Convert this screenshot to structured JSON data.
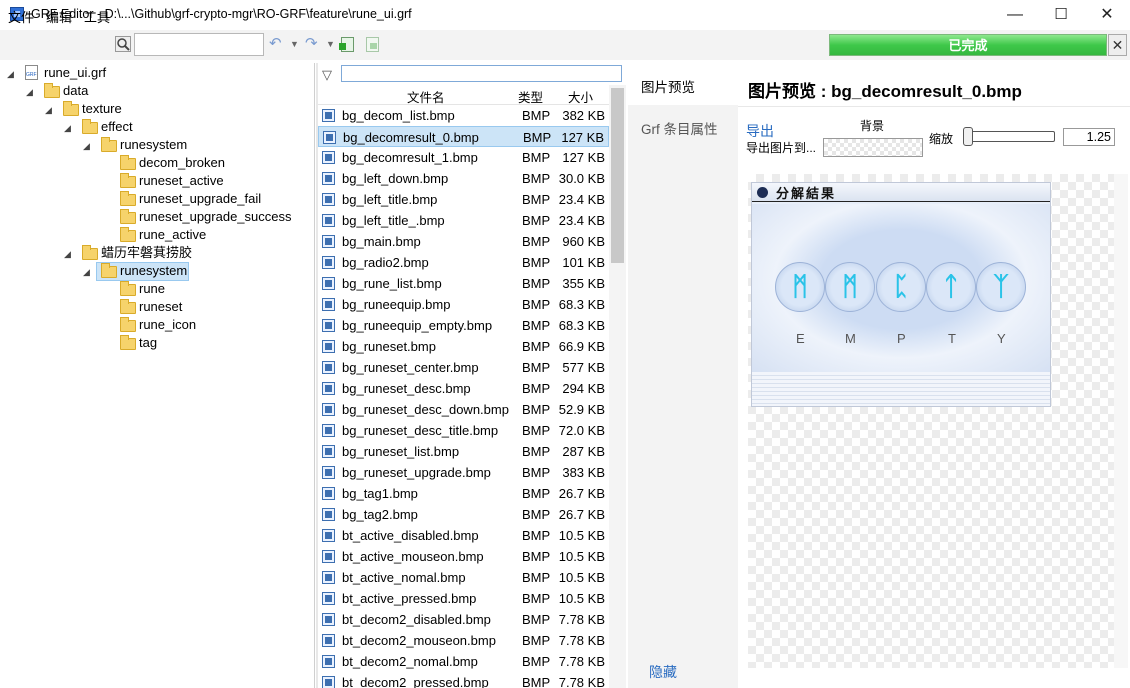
{
  "window": {
    "title": "GRF Editor - D:\\...\\Github\\grf-crypto-mgr\\RO-GRF\\feature\\rune_ui.grf",
    "minimize": "—",
    "maximize": "☐",
    "close": "✕"
  },
  "menu": {
    "file": "文件",
    "edit": "编辑",
    "tools": "工具"
  },
  "toolbar": {
    "search_value": "",
    "undo": "↶",
    "redo": "↷"
  },
  "progress": {
    "label": "已完成",
    "close": "✕",
    "percent": 100
  },
  "tree": {
    "root": "rune_ui.grf",
    "data": "data",
    "texture": "texture",
    "effect": "effect",
    "runesystem_a": "runesystem",
    "runesystem_a_children": [
      "decom_broken",
      "runeset_active",
      "runeset_upgrade_fail",
      "runeset_upgrade_success",
      "rune_active"
    ],
    "garbled": "蜡历牢磐萁捞胶",
    "runesystem_b": "runesystem",
    "runesystem_b_children": [
      "rune",
      "runeset",
      "rune_icon",
      "tag"
    ]
  },
  "filelist": {
    "filter_value": "",
    "headers": {
      "name": "文件名",
      "type": "类型",
      "size": "大小"
    },
    "rows": [
      {
        "name": "bg_decom_list.bmp",
        "type": "BMP",
        "size": "382 KB"
      },
      {
        "name": "bg_decomresult_0.bmp",
        "type": "BMP",
        "size": "127 KB"
      },
      {
        "name": "bg_decomresult_1.bmp",
        "type": "BMP",
        "size": "127 KB"
      },
      {
        "name": "bg_left_down.bmp",
        "type": "BMP",
        "size": "30.0 KB"
      },
      {
        "name": "bg_left_title.bmp",
        "type": "BMP",
        "size": "23.4 KB"
      },
      {
        "name": "bg_left_title_.bmp",
        "type": "BMP",
        "size": "23.4 KB"
      },
      {
        "name": "bg_main.bmp",
        "type": "BMP",
        "size": "960 KB"
      },
      {
        "name": "bg_radio2.bmp",
        "type": "BMP",
        "size": "101 KB"
      },
      {
        "name": "bg_rune_list.bmp",
        "type": "BMP",
        "size": "355 KB"
      },
      {
        "name": "bg_runeequip.bmp",
        "type": "BMP",
        "size": "68.3 KB"
      },
      {
        "name": "bg_runeequip_empty.bmp",
        "type": "BMP",
        "size": "68.3 KB"
      },
      {
        "name": "bg_runeset.bmp",
        "type": "BMP",
        "size": "66.9 KB"
      },
      {
        "name": "bg_runeset_center.bmp",
        "type": "BMP",
        "size": "577 KB"
      },
      {
        "name": "bg_runeset_desc.bmp",
        "type": "BMP",
        "size": "294 KB"
      },
      {
        "name": "bg_runeset_desc_down.bmp",
        "type": "BMP",
        "size": "52.9 KB"
      },
      {
        "name": "bg_runeset_desc_title.bmp",
        "type": "BMP",
        "size": "72.0 KB"
      },
      {
        "name": "bg_runeset_list.bmp",
        "type": "BMP",
        "size": "287 KB"
      },
      {
        "name": "bg_runeset_upgrade.bmp",
        "type": "BMP",
        "size": "383 KB"
      },
      {
        "name": "bg_tag1.bmp",
        "type": "BMP",
        "size": "26.7 KB"
      },
      {
        "name": "bg_tag2.bmp",
        "type": "BMP",
        "size": "26.7 KB"
      },
      {
        "name": "bt_active_disabled.bmp",
        "type": "BMP",
        "size": "10.5 KB"
      },
      {
        "name": "bt_active_mouseon.bmp",
        "type": "BMP",
        "size": "10.5 KB"
      },
      {
        "name": "bt_active_nomal.bmp",
        "type": "BMP",
        "size": "10.5 KB"
      },
      {
        "name": "bt_active_pressed.bmp",
        "type": "BMP",
        "size": "10.5 KB"
      },
      {
        "name": "bt_decom2_disabled.bmp",
        "type": "BMP",
        "size": "7.78 KB"
      },
      {
        "name": "bt_decom2_mouseon.bmp",
        "type": "BMP",
        "size": "7.78 KB"
      },
      {
        "name": "bt_decom2_nomal.bmp",
        "type": "BMP",
        "size": "7.78 KB"
      },
      {
        "name": "bt_decom2_pressed.bmp",
        "type": "BMP",
        "size": "7.78 KB"
      }
    ]
  },
  "tabs": {
    "preview": "图片预览",
    "properties": "Grf 条目属性",
    "hide": "隐藏"
  },
  "preview": {
    "title": "图片预览 : bg_decomresult_0.bmp",
    "export": "导出",
    "export_to": "导出图片到...",
    "background": "背景",
    "zoom_label": "缩放",
    "zoom_value": "1.25",
    "image_title": "分解結果",
    "runes": [
      "ᛗ",
      "ᛗ",
      "ᛈ",
      "ᛏ",
      "ᛉ"
    ],
    "empty_letters": [
      "E",
      "M",
      "P",
      "T",
      "Y"
    ]
  }
}
